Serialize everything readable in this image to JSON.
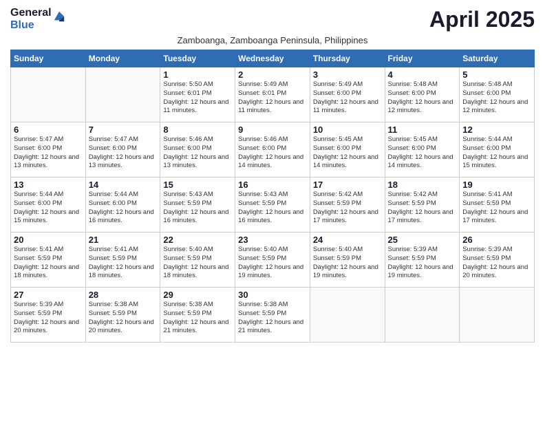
{
  "logo": {
    "general": "General",
    "blue": "Blue"
  },
  "title": "April 2025",
  "subtitle": "Zamboanga, Zamboanga Peninsula, Philippines",
  "days_of_week": [
    "Sunday",
    "Monday",
    "Tuesday",
    "Wednesday",
    "Thursday",
    "Friday",
    "Saturday"
  ],
  "weeks": [
    [
      {
        "day": "",
        "info": ""
      },
      {
        "day": "",
        "info": ""
      },
      {
        "day": "1",
        "info": "Sunrise: 5:50 AM\nSunset: 6:01 PM\nDaylight: 12 hours and 11 minutes."
      },
      {
        "day": "2",
        "info": "Sunrise: 5:49 AM\nSunset: 6:01 PM\nDaylight: 12 hours and 11 minutes."
      },
      {
        "day": "3",
        "info": "Sunrise: 5:49 AM\nSunset: 6:00 PM\nDaylight: 12 hours and 11 minutes."
      },
      {
        "day": "4",
        "info": "Sunrise: 5:48 AM\nSunset: 6:00 PM\nDaylight: 12 hours and 12 minutes."
      },
      {
        "day": "5",
        "info": "Sunrise: 5:48 AM\nSunset: 6:00 PM\nDaylight: 12 hours and 12 minutes."
      }
    ],
    [
      {
        "day": "6",
        "info": "Sunrise: 5:47 AM\nSunset: 6:00 PM\nDaylight: 12 hours and 13 minutes."
      },
      {
        "day": "7",
        "info": "Sunrise: 5:47 AM\nSunset: 6:00 PM\nDaylight: 12 hours and 13 minutes."
      },
      {
        "day": "8",
        "info": "Sunrise: 5:46 AM\nSunset: 6:00 PM\nDaylight: 12 hours and 13 minutes."
      },
      {
        "day": "9",
        "info": "Sunrise: 5:46 AM\nSunset: 6:00 PM\nDaylight: 12 hours and 14 minutes."
      },
      {
        "day": "10",
        "info": "Sunrise: 5:45 AM\nSunset: 6:00 PM\nDaylight: 12 hours and 14 minutes."
      },
      {
        "day": "11",
        "info": "Sunrise: 5:45 AM\nSunset: 6:00 PM\nDaylight: 12 hours and 14 minutes."
      },
      {
        "day": "12",
        "info": "Sunrise: 5:44 AM\nSunset: 6:00 PM\nDaylight: 12 hours and 15 minutes."
      }
    ],
    [
      {
        "day": "13",
        "info": "Sunrise: 5:44 AM\nSunset: 6:00 PM\nDaylight: 12 hours and 15 minutes."
      },
      {
        "day": "14",
        "info": "Sunrise: 5:44 AM\nSunset: 6:00 PM\nDaylight: 12 hours and 16 minutes."
      },
      {
        "day": "15",
        "info": "Sunrise: 5:43 AM\nSunset: 5:59 PM\nDaylight: 12 hours and 16 minutes."
      },
      {
        "day": "16",
        "info": "Sunrise: 5:43 AM\nSunset: 5:59 PM\nDaylight: 12 hours and 16 minutes."
      },
      {
        "day": "17",
        "info": "Sunrise: 5:42 AM\nSunset: 5:59 PM\nDaylight: 12 hours and 17 minutes."
      },
      {
        "day": "18",
        "info": "Sunrise: 5:42 AM\nSunset: 5:59 PM\nDaylight: 12 hours and 17 minutes."
      },
      {
        "day": "19",
        "info": "Sunrise: 5:41 AM\nSunset: 5:59 PM\nDaylight: 12 hours and 17 minutes."
      }
    ],
    [
      {
        "day": "20",
        "info": "Sunrise: 5:41 AM\nSunset: 5:59 PM\nDaylight: 12 hours and 18 minutes."
      },
      {
        "day": "21",
        "info": "Sunrise: 5:41 AM\nSunset: 5:59 PM\nDaylight: 12 hours and 18 minutes."
      },
      {
        "day": "22",
        "info": "Sunrise: 5:40 AM\nSunset: 5:59 PM\nDaylight: 12 hours and 18 minutes."
      },
      {
        "day": "23",
        "info": "Sunrise: 5:40 AM\nSunset: 5:59 PM\nDaylight: 12 hours and 19 minutes."
      },
      {
        "day": "24",
        "info": "Sunrise: 5:40 AM\nSunset: 5:59 PM\nDaylight: 12 hours and 19 minutes."
      },
      {
        "day": "25",
        "info": "Sunrise: 5:39 AM\nSunset: 5:59 PM\nDaylight: 12 hours and 19 minutes."
      },
      {
        "day": "26",
        "info": "Sunrise: 5:39 AM\nSunset: 5:59 PM\nDaylight: 12 hours and 20 minutes."
      }
    ],
    [
      {
        "day": "27",
        "info": "Sunrise: 5:39 AM\nSunset: 5:59 PM\nDaylight: 12 hours and 20 minutes."
      },
      {
        "day": "28",
        "info": "Sunrise: 5:38 AM\nSunset: 5:59 PM\nDaylight: 12 hours and 20 minutes."
      },
      {
        "day": "29",
        "info": "Sunrise: 5:38 AM\nSunset: 5:59 PM\nDaylight: 12 hours and 21 minutes."
      },
      {
        "day": "30",
        "info": "Sunrise: 5:38 AM\nSunset: 5:59 PM\nDaylight: 12 hours and 21 minutes."
      },
      {
        "day": "",
        "info": ""
      },
      {
        "day": "",
        "info": ""
      },
      {
        "day": "",
        "info": ""
      }
    ]
  ]
}
